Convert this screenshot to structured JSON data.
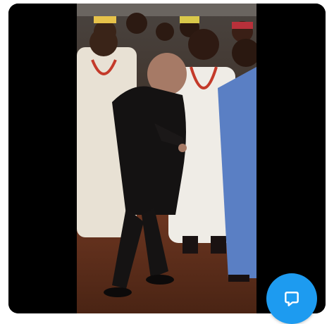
{
  "media": {
    "type": "video",
    "scene": "dance"
  },
  "fab": {
    "icon": "chat-bubble-icon",
    "color": "#1d9bf0"
  },
  "colors": {
    "letterbox": "#000000",
    "background": "#ffffff"
  }
}
